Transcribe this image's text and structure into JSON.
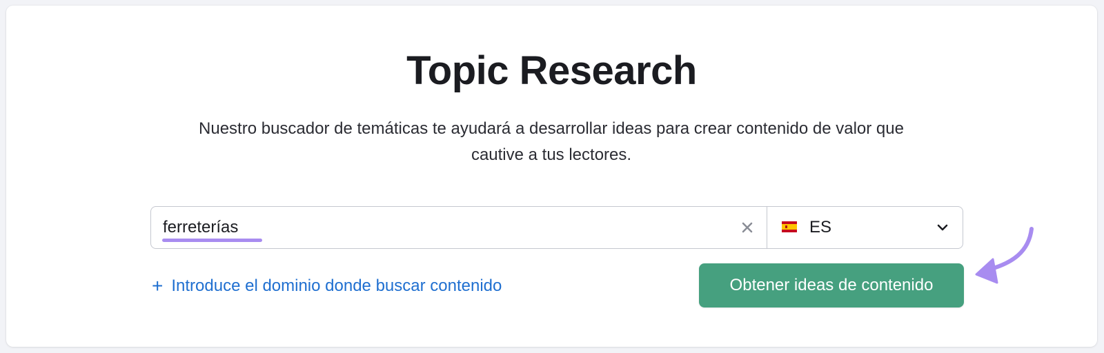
{
  "header": {
    "title": "Topic Research",
    "description": "Nuestro buscador de temáticas te ayudará a desarrollar ideas para crear contenido de valor que cautive a tus lectores."
  },
  "search": {
    "value": "ferreterías",
    "placeholder": "",
    "clear_icon": "close-icon"
  },
  "database": {
    "flag_icon": "spain-flag-icon",
    "selected": "ES",
    "dropdown_icon": "chevron-down-icon"
  },
  "add_domain": {
    "icon": "plus-icon",
    "plus": "+",
    "label": "Introduce el dominio donde buscar contenido"
  },
  "cta": {
    "label": "Obtener ideas de contenido"
  },
  "colors": {
    "accent_green": "#46a07f",
    "link_blue": "#1f6fd0",
    "highlight_purple": "#a88cf0"
  }
}
